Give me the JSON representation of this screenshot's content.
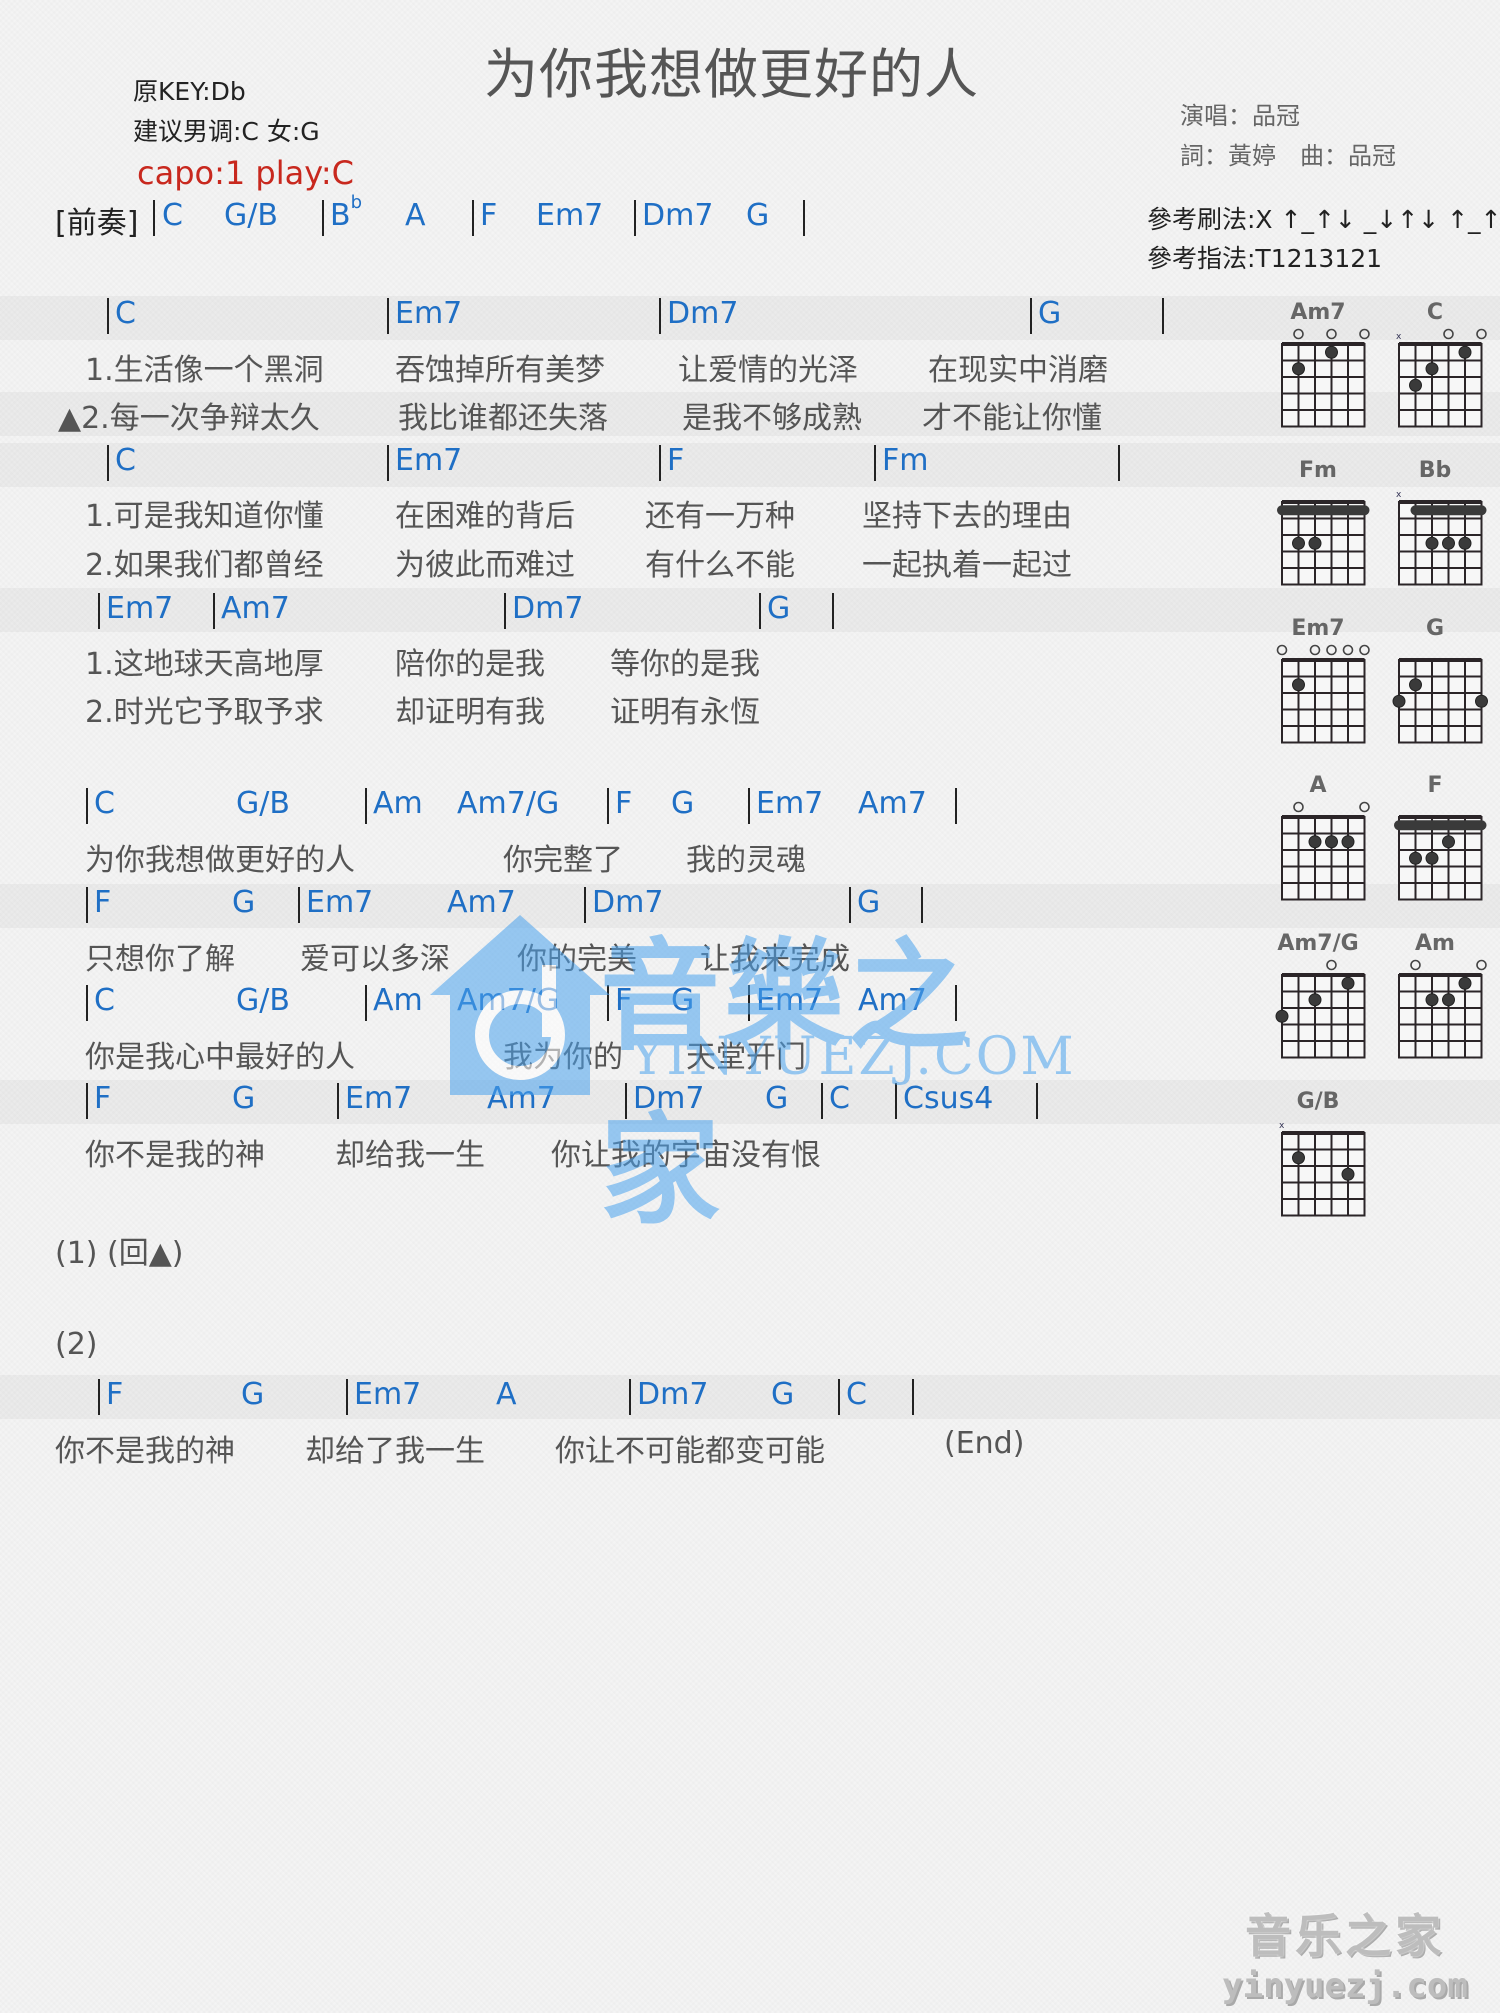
{
  "title": "为你我想做更好的人",
  "meta": {
    "original_key": "原KEY:Db",
    "suggested_key": "建议男调:C 女:G",
    "capo": "capo:1 play:C"
  },
  "credits": {
    "singer": "演唱：品冠",
    "writers": "詞：黃婷　曲：品冠"
  },
  "reference": {
    "strum": "參考刷法:X ↑_↑↓ _↓↑↓ ↑_↑↓",
    "fingerpick": "參考指法:T1213121"
  },
  "intro": {
    "label": "[前奏]",
    "chords": [
      "C",
      "G/B",
      "B",
      "A",
      "F",
      "Em7",
      "Dm7",
      "G"
    ],
    "flat_sup": "b"
  },
  "verse": [
    {
      "chords": [
        "C",
        "Em7",
        "Dm7",
        "G"
      ],
      "lyrics": [
        [
          "1.生活像一个黑洞",
          "吞蚀掉所有美梦",
          "让爱情的光泽",
          "在现实中消磨"
        ],
        [
          "▲2.每一次争辩太久",
          "我比谁都还失落",
          "是我不够成熟",
          "才不能让你懂"
        ]
      ]
    },
    {
      "chords": [
        "C",
        "Em7",
        "F",
        "Fm"
      ],
      "lyrics": [
        [
          "1.可是我知道你懂",
          "在困难的背后",
          "还有一万种",
          "坚持下去的理由"
        ],
        [
          "2.如果我们都曾经",
          "为彼此而难过",
          "有什么不能",
          "一起执着一起过"
        ]
      ]
    },
    {
      "chords": [
        "Em7",
        "Am7",
        "Dm7",
        "G"
      ],
      "lyrics": [
        [
          "1.这地球天高地厚",
          "陪你的是我",
          "等你的是我"
        ],
        [
          "2.时光它予取予求",
          "却证明有我",
          "证明有永恆"
        ]
      ]
    }
  ],
  "chorus": [
    {
      "chords": [
        "C",
        "G/B",
        "Am",
        "Am7/G",
        "F",
        "G",
        "Em7",
        "Am7"
      ],
      "lyrics": [
        "为你我想做更好的人",
        "你完整了",
        "我的灵魂"
      ]
    },
    {
      "chords": [
        "F",
        "G",
        "Em7",
        "Am7",
        "Dm7",
        "G"
      ],
      "lyrics": [
        "只想你了解",
        "爱可以多深",
        "你的完美",
        "让我来完成"
      ]
    },
    {
      "chords": [
        "C",
        "G/B",
        "Am",
        "Am7/G",
        "F",
        "G",
        "Em7",
        "Am7"
      ],
      "lyrics": [
        "你是我心中最好的人",
        "我为你的",
        "天堂开门"
      ]
    },
    {
      "chords": [
        "F",
        "G",
        "Em7",
        "Am7",
        "Dm7",
        "G",
        "C",
        "Csus4"
      ],
      "lyrics": [
        "你不是我的神",
        "却给我一生",
        "你让我的宇宙没有恨"
      ]
    }
  ],
  "repeat_1": "(1)  (回▲)",
  "ending": {
    "label": "(2)",
    "chords": [
      "F",
      "G",
      "Em7",
      "A",
      "Dm7",
      "G",
      "C"
    ],
    "lyrics": [
      "你不是我的神",
      "却给了我一生",
      "你让不可能都变可能",
      "(End)"
    ]
  },
  "chord_diagrams": [
    {
      "name": "Am7",
      "open": [
        2,
        4,
        6
      ],
      "mute": [],
      "dots": [
        [
          4,
          1
        ],
        [
          2,
          2
        ]
      ],
      "barre": null
    },
    {
      "name": "C",
      "open": [
        4,
        6
      ],
      "mute": [
        1
      ],
      "dots": [
        [
          5,
          1
        ],
        [
          3,
          2
        ],
        [
          2,
          3
        ]
      ],
      "barre": null
    },
    {
      "name": "Fm",
      "open": [],
      "mute": [],
      "dots": [
        [
          2,
          3
        ],
        [
          3,
          3
        ]
      ],
      "barre": {
        "fret": 1,
        "from": 1,
        "to": 6
      }
    },
    {
      "name": "Bb",
      "open": [],
      "mute": [
        1
      ],
      "dots": [
        [
          3,
          3
        ],
        [
          4,
          3
        ],
        [
          5,
          3
        ]
      ],
      "barre": {
        "fret": 1,
        "from": 2,
        "to": 6
      }
    },
    {
      "name": "Em7",
      "open": [
        1,
        3,
        4,
        5,
        6
      ],
      "mute": [],
      "dots": [
        [
          2,
          2
        ]
      ],
      "barre": null
    },
    {
      "name": "G",
      "open": [],
      "mute": [],
      "dots": [
        [
          2,
          2
        ],
        [
          1,
          3
        ],
        [
          6,
          3
        ]
      ],
      "barre": null
    },
    {
      "name": "A",
      "open": [
        2,
        6
      ],
      "mute": [],
      "dots": [
        [
          3,
          2
        ],
        [
          4,
          2
        ],
        [
          5,
          2
        ]
      ],
      "barre": null
    },
    {
      "name": "F",
      "open": [],
      "mute": [],
      "dots": [
        [
          4,
          2
        ],
        [
          2,
          3
        ],
        [
          3,
          3
        ]
      ],
      "barre": {
        "fret": 1,
        "from": 1,
        "to": 6
      }
    },
    {
      "name": "Am7/G",
      "open": [
        4
      ],
      "mute": [],
      "dots": [
        [
          5,
          1
        ],
        [
          3,
          2
        ],
        [
          1,
          3
        ]
      ],
      "barre": null
    },
    {
      "name": "Am",
      "open": [
        2,
        6
      ],
      "mute": [],
      "dots": [
        [
          5,
          1
        ],
        [
          3,
          2
        ],
        [
          4,
          2
        ]
      ],
      "barre": null
    },
    {
      "name": "G/B",
      "open": [],
      "mute": [
        1
      ],
      "dots": [
        [
          2,
          2
        ],
        [
          5,
          3
        ]
      ],
      "barre": null
    }
  ],
  "watermark": {
    "cn": "音樂之家",
    "url": "YINYUEZJ.COM"
  },
  "logo": {
    "cn": "音乐之家",
    "url": "yinyuezj.com"
  },
  "colors": {
    "chord": "#1f6fc5",
    "capo": "#c8281e",
    "lyric": "#555555",
    "watermark": "#4aa3ef"
  }
}
